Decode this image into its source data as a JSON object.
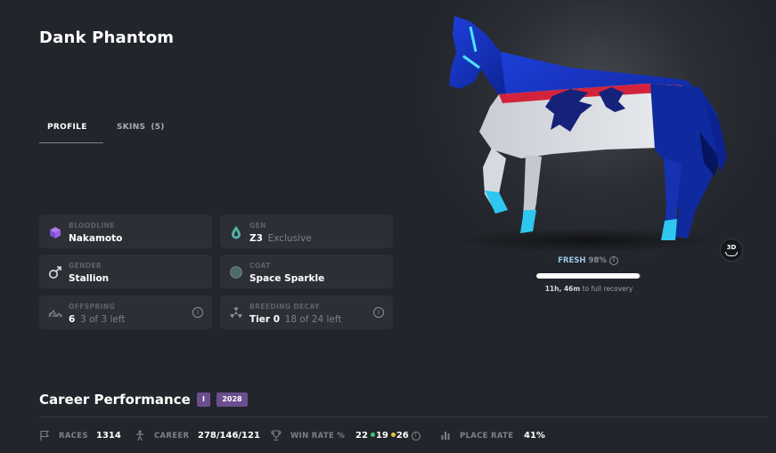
{
  "horse": {
    "name": "Dank Phantom"
  },
  "tabs": [
    {
      "label": "PROFILE",
      "active": true
    },
    {
      "label": "SKINS",
      "count": "(5)"
    }
  ],
  "attributes": {
    "bloodline": {
      "label": "BLOODLINE",
      "value": "Nakamoto",
      "icon": "bloodline-cube-icon"
    },
    "gen": {
      "label": "GEN",
      "value": "Z3",
      "sub": "Exclusive",
      "icon": "drop-icon"
    },
    "gender": {
      "label": "GENDER",
      "value": "Stallion",
      "icon": "male-icon"
    },
    "coat": {
      "label": "COAT",
      "value": "Space Sparkle",
      "icon": "coat-swatch-icon",
      "swatch_color": "#4f6a6c"
    },
    "offspring": {
      "label": "OFFSPRING",
      "value": "6",
      "sub": "3 of 3 left",
      "icon": "offspring-icon"
    },
    "breeding_decay": {
      "label": "BREEDING DECAY",
      "value": "Tier 0",
      "sub": "18 of 24 left",
      "icon": "radiation-icon"
    }
  },
  "status": {
    "label": "FRESH",
    "percent_text": "98%",
    "percent_value": 0.98,
    "recovery_time": "11h, 46m",
    "recovery_suffix": "to full recovery"
  },
  "viewer": {
    "button_label": "3D"
  },
  "career": {
    "title": "Career Performance",
    "badges": [
      "I",
      "2028"
    ],
    "races": {
      "label": "RACES",
      "value": "1314"
    },
    "career": {
      "label": "CAREER",
      "value": "278/146/121"
    },
    "win_rate": {
      "label": "WIN RATE %",
      "value": "22",
      "secondary": "19",
      "tertiary": "26",
      "secondary_color": "#3fc47a",
      "tertiary_color": "#e6c33a"
    },
    "place_rate": {
      "label": "PLACE RATE",
      "value": "41%"
    }
  },
  "colors": {
    "background": "#22252b",
    "card": "#2c2f36",
    "badge": "#6b4e8f",
    "fresh_label": "#9cc6e0"
  }
}
